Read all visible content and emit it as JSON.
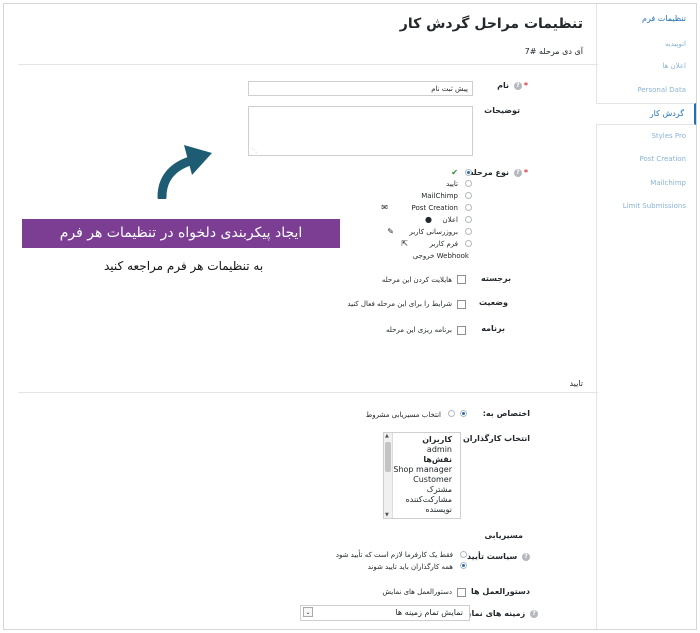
{
  "sidebar": {
    "items": [
      {
        "label": "تنظیمات فرم"
      },
      {
        "label": "اتوپیدیه"
      },
      {
        "label": "اعلان ها"
      },
      {
        "label": "Personal Data"
      },
      {
        "label": "گردش کار"
      },
      {
        "label": "Styles Pro"
      },
      {
        "label": "Post Creation"
      },
      {
        "label": "Mailchimp"
      },
      {
        "label": "Limit Submissions"
      }
    ]
  },
  "header": {
    "title": "تنظیمات مراحل گردش کار",
    "subtitle": "آی دی مرحله #7"
  },
  "form": {
    "name_label": "نام",
    "name_value": "پیش ثبت نام",
    "description_label": "توضیحات",
    "step_type_label": "نوع مرحله",
    "step_types": [
      "تایید",
      "MailChimp",
      "Post Creation",
      "اعلان",
      "بروزرسانی کاربر",
      "فرم کاربر",
      "Webhook خروجی"
    ],
    "highlight_label": "برجسته",
    "highlight_option": "هایلایت کردن این مرحله",
    "status_label": "وضعیت",
    "status_option": "شرایط را برای این مرحله فعال کنید",
    "schedule_label": "برنامه",
    "schedule_option": "برنامه ریزی این مرحله"
  },
  "approval": {
    "section_title": "تایید",
    "assign_label": "اختصاص به:",
    "assign_option": "انتخاب مسیریابی مشروط",
    "assignees_label": "انتخاب کارگذاران",
    "assignees": [
      {
        "text": "کاربران",
        "group": true
      },
      {
        "text": "admin",
        "group": false
      },
      {
        "text": "نقش‌ها",
        "group": true
      },
      {
        "text": "Shop manager",
        "group": false
      },
      {
        "text": "Customer",
        "group": false
      },
      {
        "text": "مشترک",
        "group": false
      },
      {
        "text": "مشارکت‌کننده",
        "group": false
      },
      {
        "text": "نویسنده",
        "group": false
      }
    ],
    "routing_label": "مسیریابی",
    "policy_label": "سیاست تأیید",
    "policy_option_1": "فقط یک کارفرما لازم است که تأیید شود",
    "policy_option_2": "همه کارگذاران باید تایید شوند",
    "instructions_label": "دستورالعمل ها",
    "instructions_option": "دستورالعمل های نمایش",
    "display_fields_label": "زمینه های نمایش",
    "display_fields_value": "نمایش تمام زمینه ها"
  },
  "promo": {
    "banner": "ایجاد پیکربندی دلخواه در تنظیمات هر فرم",
    "subtext": "به تنظیمات هر فرم مراجعه کنید"
  },
  "colors": {
    "accent": "#2271b1",
    "promo": "#7b3e93",
    "promo_arrow": "#1e5c74"
  }
}
